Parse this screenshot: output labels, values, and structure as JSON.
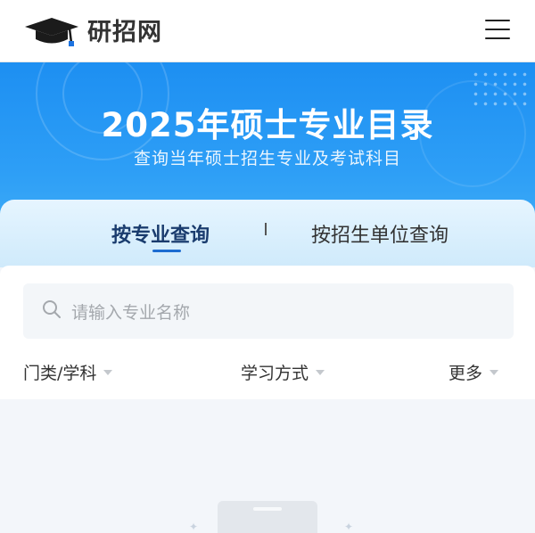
{
  "header": {
    "site_name": "研招网",
    "logo_icon": "graduation-cap-icon",
    "menu_icon": "hamburger-menu-icon"
  },
  "banner": {
    "title": "2025年硕士专业目录",
    "subtitle": "查询当年硕士招生专业及考试科目"
  },
  "tabs": [
    {
      "label": "按专业查询",
      "active": true
    },
    {
      "label": "按招生单位查询",
      "active": false
    }
  ],
  "search": {
    "placeholder": "请输入专业名称",
    "icon": "search-icon"
  },
  "filters": [
    {
      "label": "门类/学科"
    },
    {
      "label": "学习方式"
    },
    {
      "label": "更多"
    }
  ],
  "colors": {
    "banner_blue": "#1d8ff2",
    "active_tab_text": "#1a3c6e",
    "tab_underline": "#1d6cd1"
  }
}
